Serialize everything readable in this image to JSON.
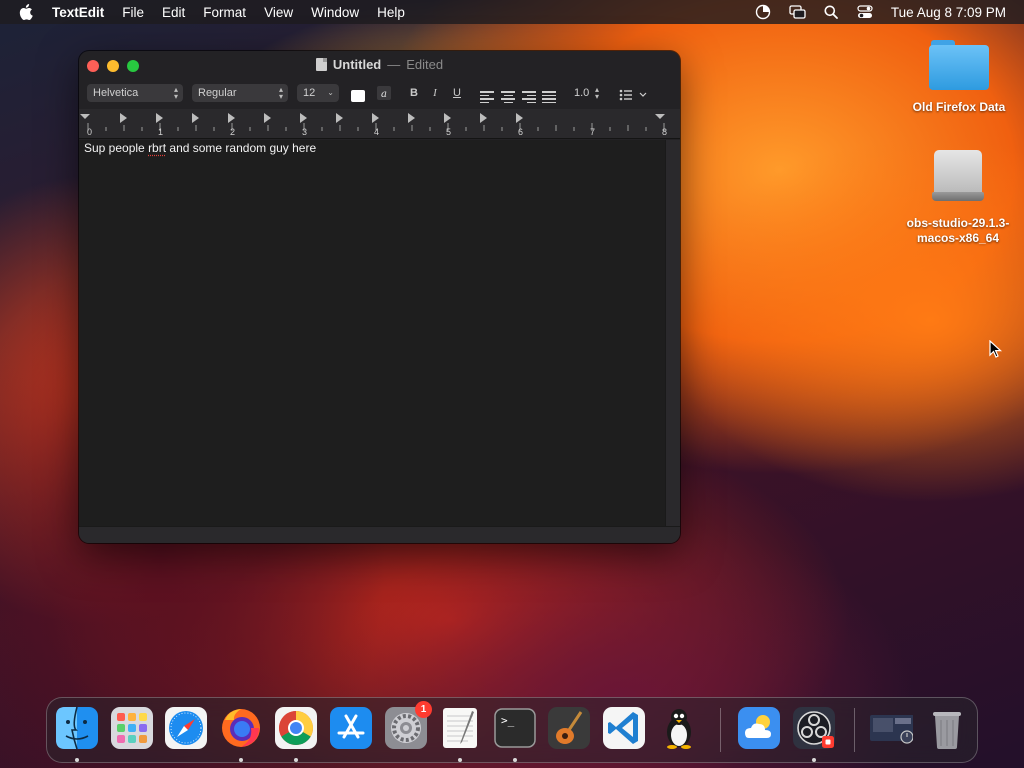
{
  "menubar": {
    "app_name": "TextEdit",
    "items": [
      "File",
      "Edit",
      "Format",
      "View",
      "Window",
      "Help"
    ],
    "clock": "Tue Aug 8  7:09 PM"
  },
  "window": {
    "title": "Untitled",
    "separator": "—",
    "status": "Edited",
    "toolbar": {
      "font_family": "Helvetica",
      "font_style": "Regular",
      "font_size": "12",
      "bold": "B",
      "italic": "I",
      "underline": "U",
      "line_spacing": "1.0"
    },
    "ruler_numbers": [
      "0",
      "1",
      "2",
      "3",
      "4",
      "5",
      "6",
      "7",
      "8"
    ],
    "document": {
      "before": "Sup people ",
      "misspelled": "rbrt",
      "after": " and some random guy here"
    }
  },
  "desktop": {
    "icons": [
      {
        "label": "Old Firefox Data",
        "icon": "folder-icon"
      },
      {
        "label": "obs-studio-29.1.3-macos-x86_64",
        "icon": "disk-image-icon"
      }
    ]
  },
  "dock": {
    "system_settings_badge": "1",
    "terminal_prompt": ">_",
    "items": [
      "Finder",
      "Launchpad",
      "Safari",
      "Firefox",
      "Google Chrome",
      "App Store",
      "System Settings",
      "TextEdit",
      "Terminal",
      "GarageBand",
      "Visual Studio Code",
      "Tux",
      "Weather",
      "OBS",
      "Window Thumbnail",
      "Trash"
    ]
  },
  "colors": {
    "traffic_close": "#fe5f57",
    "traffic_minimize": "#febc2e",
    "traffic_zoom": "#28c840",
    "badge": "#ff3b30"
  }
}
